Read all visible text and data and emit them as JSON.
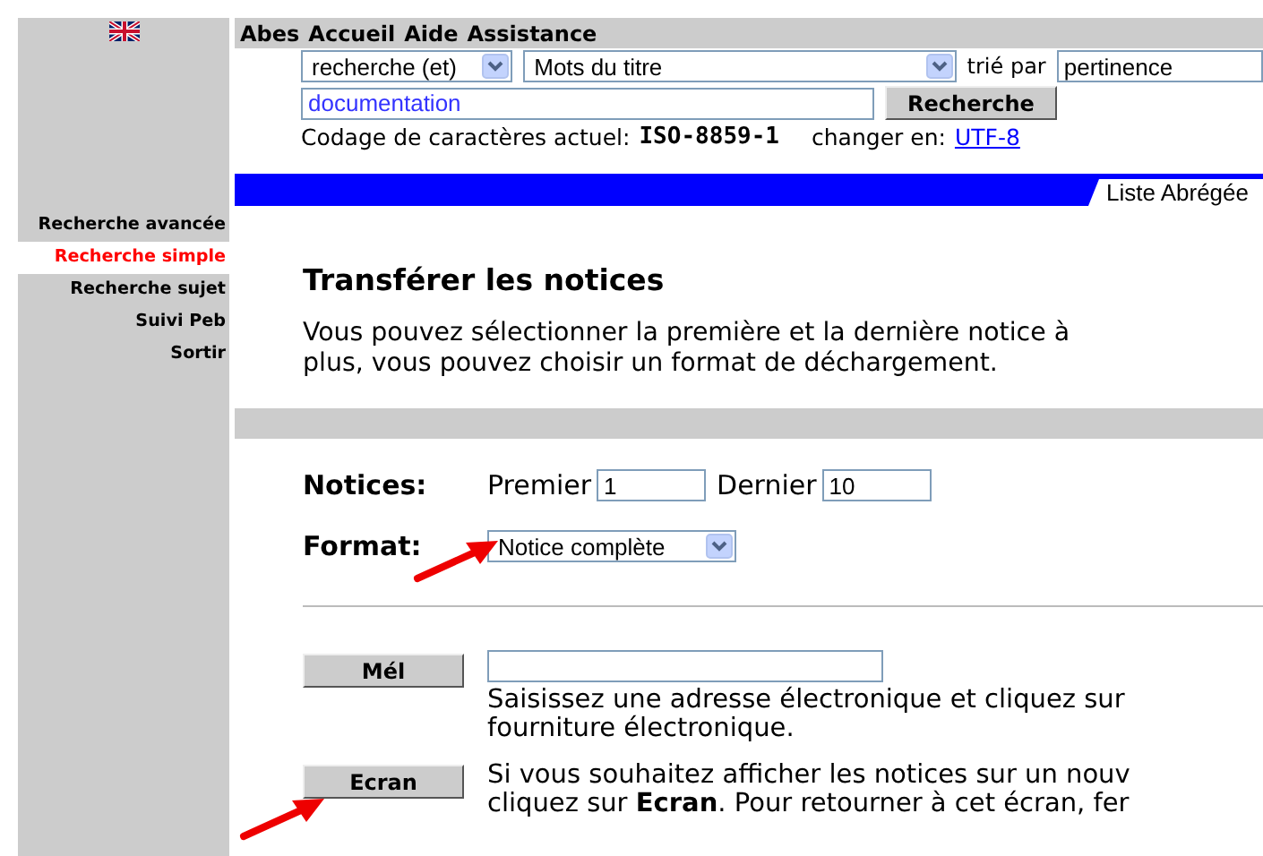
{
  "top_menu": [
    "Abes",
    "Accueil",
    "Aide",
    "Assistance"
  ],
  "search": {
    "operator": "recherche (et)",
    "field": "Mots du titre",
    "sort_label": "trié par",
    "sort": "pertinence",
    "query": "documentation",
    "button": "Recherche",
    "encoding_label": "Codage de caractères actuel:",
    "encoding": "ISO-8859-1",
    "change_label": "changer en:",
    "change_link": "UTF-8"
  },
  "view_tab": "Liste Abrégée",
  "sidebar": {
    "items": [
      {
        "label": "Recherche avancée",
        "selected": false
      },
      {
        "label": "Recherche simple",
        "selected": true
      },
      {
        "label": "Recherche sujet",
        "selected": false
      },
      {
        "label": "Suivi Peb",
        "selected": false
      },
      {
        "label": "Sortir",
        "selected": false
      }
    ]
  },
  "title": "Transférer les notices",
  "intro": [
    "Vous pouvez sélectionner la première et la dernière notice à",
    "plus, vous pouvez choisir un format de déchargement."
  ],
  "notices": {
    "label": "Notices:",
    "first_label": "Premier",
    "first": "1",
    "last_label": "Dernier",
    "last": "10"
  },
  "format": {
    "label": "Format:",
    "value": "Notice complète"
  },
  "actions": [
    {
      "button": "Mél",
      "kind": "email",
      "lines": [
        "Saisissez une adresse électronique et cliquez sur",
        "fourniture électronique."
      ]
    },
    {
      "button": "Ecran",
      "kind": "screen",
      "lines": [
        "Si vous souhaitez afficher les notices sur un nouv",
        "cliquez sur **Ecran**. Pour retourner à cet écran, fer"
      ]
    }
  ]
}
